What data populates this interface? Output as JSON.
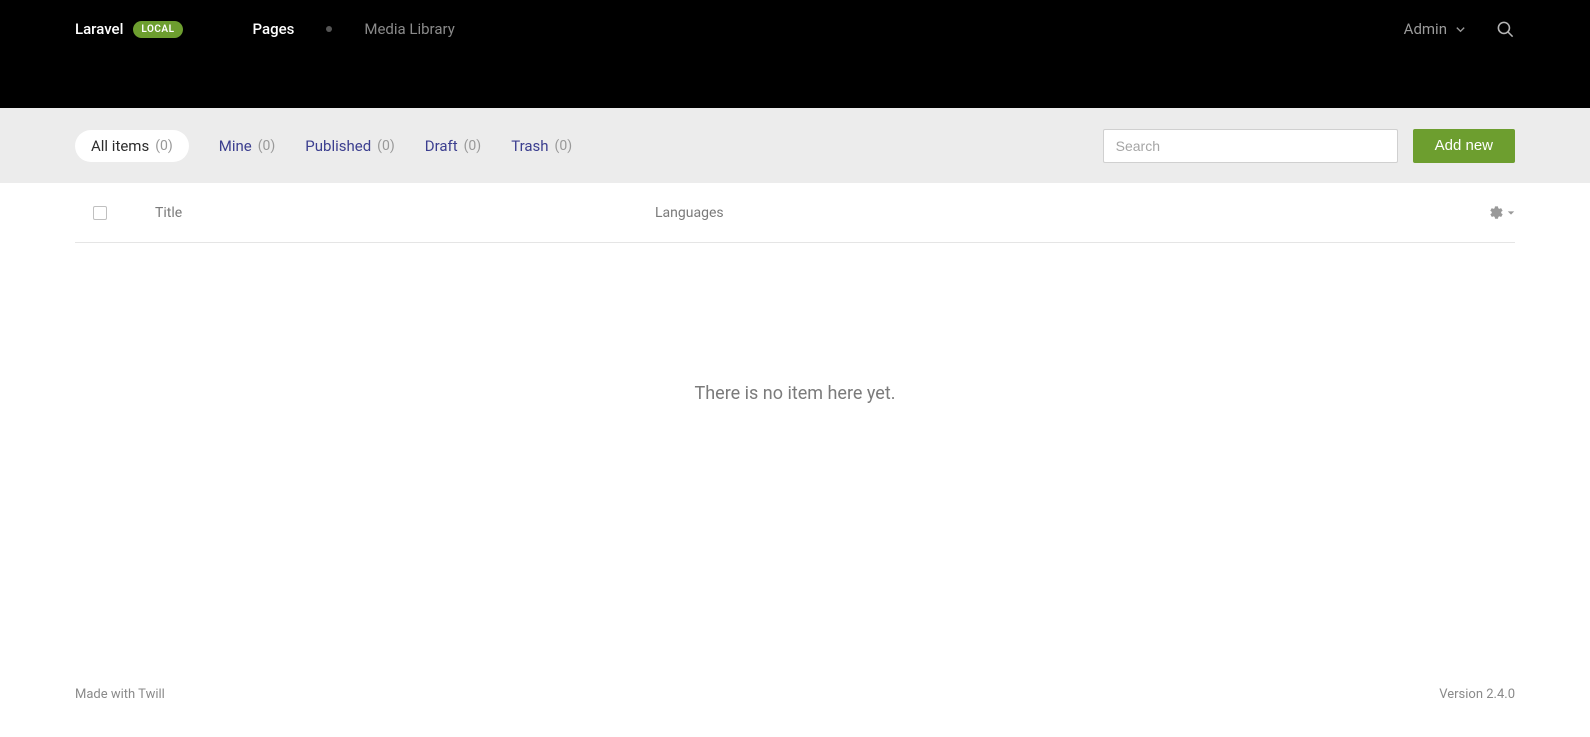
{
  "header": {
    "brand": "Laravel",
    "env_badge": "LOCAL",
    "nav": [
      {
        "label": "Pages",
        "active": true
      },
      {
        "label": "Media Library",
        "active": false
      }
    ],
    "user_menu": "Admin"
  },
  "filter": {
    "tabs": [
      {
        "label": "All items",
        "count": "(0)",
        "active": true
      },
      {
        "label": "Mine",
        "count": "(0)",
        "active": false
      },
      {
        "label": "Published",
        "count": "(0)",
        "active": false
      },
      {
        "label": "Draft",
        "count": "(0)",
        "active": false
      },
      {
        "label": "Trash",
        "count": "(0)",
        "active": false
      }
    ],
    "search_placeholder": "Search",
    "add_button": "Add new"
  },
  "table": {
    "columns": {
      "title": "Title",
      "languages": "Languages"
    },
    "empty_message": "There is no item here yet."
  },
  "footer": {
    "made_with": "Made with Twill",
    "version": "Version 2.4.0"
  }
}
